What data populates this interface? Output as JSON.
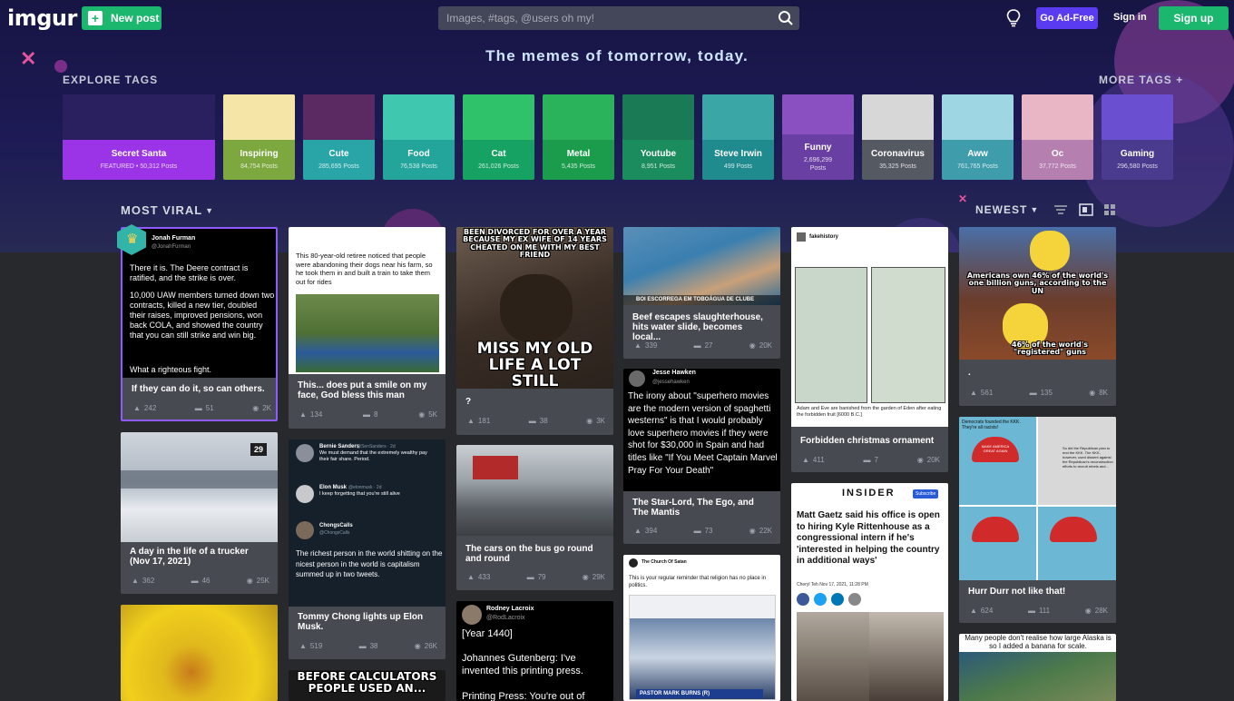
{
  "header": {
    "logo": "imgur",
    "new_post": "New post",
    "search_placeholder": "Images, #tags, @users oh my!",
    "go_ad_free": "Go Ad-Free",
    "sign_in": "Sign in",
    "sign_up": "Sign up"
  },
  "hero": {
    "tagline": "The memes of tomorrow, today.",
    "explore_tags": "EXPLORE TAGS",
    "more_tags": "MORE TAGS +"
  },
  "tags": [
    {
      "name": "Secret Santa",
      "count": "FEATURED • 50,312 Posts",
      "color": "#9b33e7",
      "img": "#2a2060"
    },
    {
      "name": "Inspiring",
      "count": "84,754 Posts",
      "color": "#7da73f",
      "img": "#f5e6a8"
    },
    {
      "name": "Cute",
      "count": "285,695 Posts",
      "color": "#29a5a8",
      "img": "#5b2a63"
    },
    {
      "name": "Food",
      "count": "76,538 Posts",
      "color": "#23a59b",
      "img": "#3fc7b0"
    },
    {
      "name": "Cat",
      "count": "261,026 Posts",
      "color": "#16a263",
      "img": "#2fc26b"
    },
    {
      "name": "Metal",
      "count": "5,435 Posts",
      "color": "#1a9c4c",
      "img": "#2ab35a"
    },
    {
      "name": "Youtube",
      "count": "8,951 Posts",
      "color": "#1b8c5d",
      "img": "#1a7a55"
    },
    {
      "name": "Steve Irwin",
      "count": "499 Posts",
      "color": "#1f8b8f",
      "img": "#3aa7a6"
    },
    {
      "name": "Funny",
      "count": "2,696,299 Posts",
      "color": "#6a3fa3",
      "img": "#8a4fc1"
    },
    {
      "name": "Coronavirus",
      "count": "35,325 Posts",
      "color": "#555962",
      "img": "#d7d7d7"
    },
    {
      "name": "Aww",
      "count": "761,765 Posts",
      "color": "#3f9cab",
      "img": "#9ed7e3"
    },
    {
      "name": "Oc",
      "count": "37,772 Posts",
      "color": "#b57fb0",
      "img": "#e8b6c5"
    },
    {
      "name": "Gaming",
      "count": "296,580 Posts",
      "color": "#4b3b8f",
      "img": "#6a4fd0"
    }
  ],
  "feed": {
    "sort_left": "MOST VIRAL",
    "sort_right": "NEWEST"
  },
  "posts": [
    {
      "title": "If they can do it, so can others.",
      "upvotes": "242",
      "comments": "51",
      "views": "2K"
    },
    {
      "title": "A day in the life of a trucker (Nov 17, 2021)",
      "upvotes": "362",
      "comments": "46",
      "views": "25K",
      "badge": "29"
    },
    {
      "title": "This... does put a smile on my face, God bless this man",
      "upvotes": "134",
      "comments": "8",
      "views": "5K"
    },
    {
      "title": "Tommy Chong lights up Elon Musk.",
      "upvotes": "519",
      "comments": "38",
      "views": "26K"
    },
    {
      "title": "?",
      "upvotes": "181",
      "comments": "38",
      "views": "3K"
    },
    {
      "title": "The cars on the bus go round and round",
      "upvotes": "433",
      "comments": "79",
      "views": "29K"
    },
    {
      "title": "Beef escapes slaughterhouse, hits water slide, becomes local...",
      "upvotes": "339",
      "comments": "27",
      "views": "20K"
    },
    {
      "title": "The Star-Lord, The Ego, and The Mantis",
      "upvotes": "394",
      "comments": "73",
      "views": "22K"
    },
    {
      "title": "Forbidden christmas ornament",
      "upvotes": "411",
      "comments": "7",
      "views": "20K"
    },
    {
      "title": ".",
      "upvotes": "561",
      "comments": "135",
      "views": "8K"
    },
    {
      "title": "Hurr Durr not like that!",
      "upvotes": "624",
      "comments": "111",
      "views": "28K"
    }
  ],
  "thumbs": {
    "p1": {
      "name": "Jonah Furman",
      "handle": "@JonahFurman",
      "lines": [
        "There it is. The Deere contract is ratified, and the strike is over.",
        "10,000 UAW members turned down two contracts, killed a new tier, doubled their raises, improved pensions, won back COLA, and showed the country that you can still strike and win big.",
        "What a righteous fight."
      ]
    },
    "p3_text": "This 80-year-old retiree noticed that people were abandoning their dogs near his farm, so he took them in and built a train to take them out for rides",
    "p4": {
      "tweet1_name": "Bernie Sanders",
      "tweet1_handle": "@SenSanders · 2d",
      "tweet1_text": "We must demand that the extremely wealthy pay their fair share. Period.",
      "tweet2_name": "Elon Musk",
      "tweet2_handle": "@elonmusk · 2d",
      "tweet2_text": "I keep forgetting that you're still alive",
      "tweet3_name": "ChongsCalls",
      "tweet3_handle": "@ChongsCalls",
      "tweet3_text": "The richest person in the world shitting on the nicest person in the world is capitalism summed up in two tweets."
    },
    "p5_top": "BEEN DIVORCED FOR OVER A YEAR BECAUSE MY EX WIFE OF 14 YEARS CHEATED ON ME WITH MY BEST FRIEND",
    "p5_bottom": "MISS MY OLD LIFE A LOT STILL",
    "p6_caption": "BOI ESCORREGA EM TOBOÁGUA DE CLUBE",
    "p7": {
      "name": "Jesse Hawken",
      "handle": "@jessehawken",
      "text": "The irony about \"superhero movies are the modern version of spaghetti westerns\" is that I would probably love superhero movies if they were shot for $30,000 in Spain and had titles like \"If You Meet Captain Marvel Pray For Your Death\""
    },
    "p8": {
      "header": "fakehistory",
      "caption": "Adam and Eve are banished from the garden of Eden after eating the forbidden fruit [6000 B.C.]"
    },
    "p9_top": "Americans own 46% of the world's one billion guns, according to the UN",
    "p9_bottom": "46% of the world's \"registered\" guns",
    "p10_top": "Democrats founded the KKK. They're all racists!",
    "p10_right": "So did the Republican plan to end the KKK. The KKK, however, used dissent against the Republican's reconstruction efforts to recruit rebels and...",
    "p10_hat": "MAKE AMERICA GREAT AGAIN",
    "p11": {
      "author": "Rodney Lacroix",
      "handle": "@RodLacroix",
      "line1": "[Year 1440]",
      "line2": "Johannes Gutenberg: I've invented this printing press.",
      "line3": "Printing Press: You're out of"
    },
    "p12": {
      "account": "The Church Of Satan",
      "text": "This is your regular reminder that religion has no place in politics.",
      "lower": "PASTOR MARK BURNS (R)"
    },
    "p13": {
      "brand": "INSIDER",
      "subscribe": "Subscribe",
      "headline": "Matt Gaetz said his office is open to hiring Kyle Rittenhouse as a congressional intern if he's 'interested in helping the country in additional ways'",
      "byline": "Cheryl Teh  Nov 17, 2021, 11:28 PM"
    },
    "p14_top": "Many people don't realise how large Alaska is so I added a banana for scale.",
    "p15_text": "BEFORE CALCULATORS PEOPLE USED AN..."
  }
}
